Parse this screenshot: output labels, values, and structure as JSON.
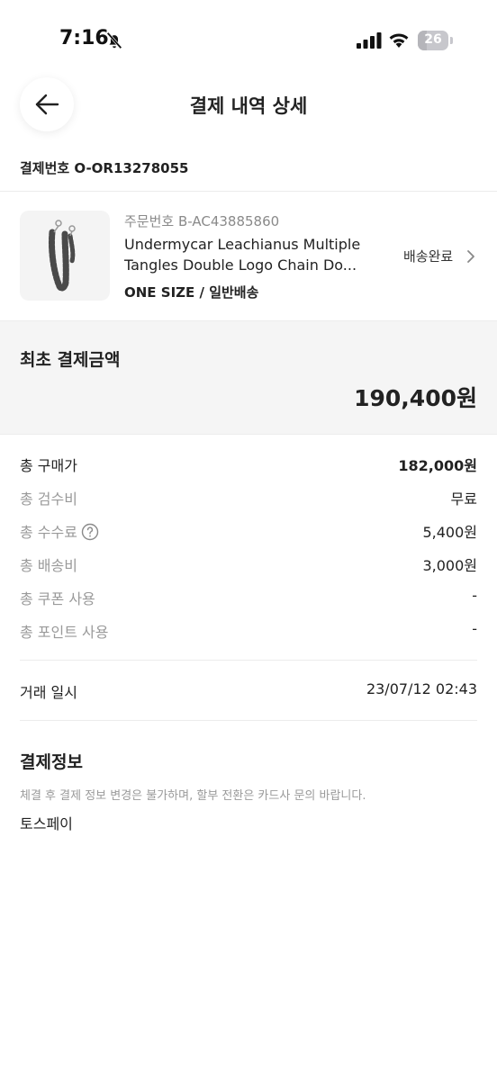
{
  "status_bar": {
    "time": "7:16",
    "battery": "26"
  },
  "header": {
    "title": "결제 내역 상세"
  },
  "payment_number": "결제번호 O-OR13278055",
  "product": {
    "order_number": "주문번호 B-AC43885860",
    "name_line1": "Undermycar Leachianus Multiple",
    "name_line2": "Tangles Double Logo Chain Do...",
    "option": "ONE SIZE / 일반배송",
    "status": "배송완료"
  },
  "total": {
    "label": "최초 결제금액",
    "amount": "190,400원"
  },
  "breakdown": [
    {
      "label": "총 구매가",
      "value": "182,000원"
    },
    {
      "label": "총 검수비",
      "value": "무료"
    },
    {
      "label": "총 수수료",
      "value": "5,400원"
    },
    {
      "label": "총 배송비",
      "value": "3,000원"
    },
    {
      "label": "총 쿠폰 사용",
      "value": "-"
    },
    {
      "label": "총 포인트 사용",
      "value": "-"
    }
  ],
  "transaction": {
    "label": "거래 일시",
    "value": "23/07/12 02:43"
  },
  "payment_info": {
    "title": "결제정보",
    "notice": "체결 후 결제 정보 변경은 불가하며, 할부 전환은 카드사 문의 바랍니다.",
    "method": "토스페이"
  },
  "icons": {
    "back": "arrow-left-icon",
    "help": "question-circle-icon",
    "chevron": "chevron-right-icon",
    "bell": "bell-off-icon"
  }
}
